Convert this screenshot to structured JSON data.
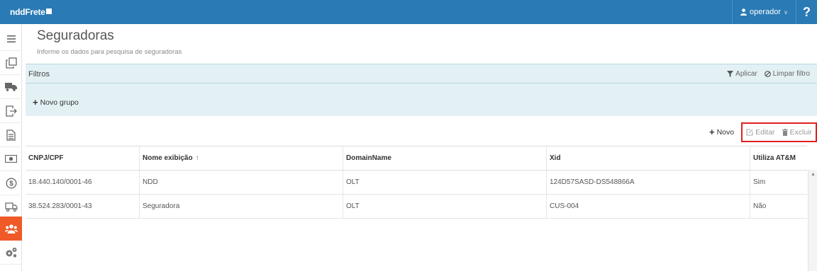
{
  "app": {
    "logo_text": "nddFrete"
  },
  "header": {
    "user_label": "operador",
    "help_label": "?"
  },
  "sidebar": {
    "items": [
      {
        "icon": "menu-icon"
      },
      {
        "icon": "documents-icon"
      },
      {
        "icon": "truck-icon"
      },
      {
        "icon": "export-icon"
      },
      {
        "icon": "file-icon"
      },
      {
        "icon": "money-icon"
      },
      {
        "icon": "dollar-circle-icon"
      },
      {
        "icon": "delivery-icon"
      },
      {
        "icon": "users-icon",
        "active": true
      },
      {
        "icon": "settings-icon"
      }
    ]
  },
  "page": {
    "title": "Seguradoras",
    "subtitle": "Informe os dados para pesquisa de seguradoras"
  },
  "filters": {
    "title": "Filtros",
    "apply_label": "Aplicar",
    "clear_label": "Limpar filtro",
    "new_group_label": "Novo grupo"
  },
  "toolbar": {
    "new_label": "Novo",
    "edit_label": "Editar",
    "delete_label": "Excluir"
  },
  "table": {
    "columns": [
      "CNPJ/CPF",
      "Nome exibição",
      "DomainName",
      "Xid",
      "Utiliza AT&M"
    ],
    "rows": [
      [
        "18.440.140/0001-46",
        "NDD",
        "OLT",
        "124D57SASD-DS548866A",
        "Sim"
      ],
      [
        "38.524.283/0001-43",
        "Seguradora",
        "OLT",
        "CUS-004",
        "Não"
      ]
    ]
  },
  "colors": {
    "topbar": "#2a7ab5",
    "active_sidebar": "#f05a28",
    "filter_bg": "#e3f1f5",
    "highlight_border": "#e02020"
  }
}
